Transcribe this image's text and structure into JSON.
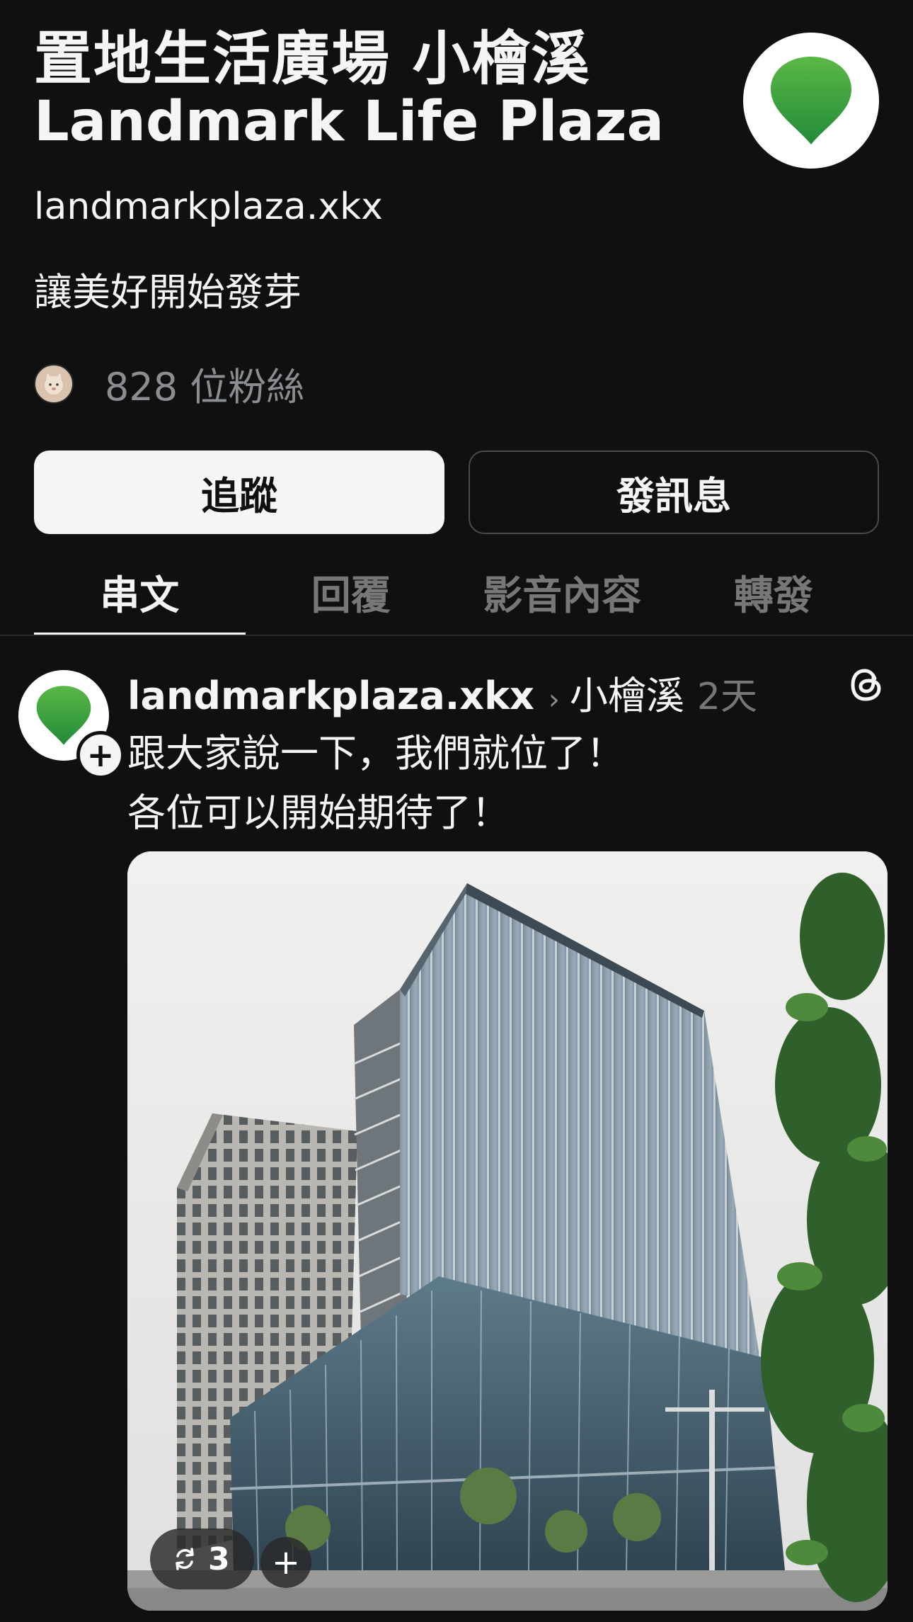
{
  "profile": {
    "name_zh": "置地生活廣場 小檜溪",
    "name_en": "Landmark Life Plaza",
    "handle": "landmarkplaza.xkx",
    "bio": "讓美好開始發芽",
    "followers": "828 位粉絲",
    "brand_color": "#3a9b3c"
  },
  "buttons": {
    "follow": "追蹤",
    "message": "發訊息"
  },
  "tabs": [
    "串文",
    "回覆",
    "影音內容",
    "轉發"
  ],
  "active_tab": "串文",
  "post": {
    "username": "landmarkplaza.xkx",
    "topic": "小檜溪",
    "time": "2天",
    "text_line1": "跟大家說一下，我們就位了！",
    "text_line2": "各位可以開始期待了！",
    "repost_count": "3",
    "add_label": "+",
    "follow_plus": "+"
  },
  "icons": {
    "avatar": "green-pin-logo-icon",
    "threads": "threads-logo-icon",
    "repost": "repost-icon",
    "chevron": "chevron-right-icon"
  }
}
